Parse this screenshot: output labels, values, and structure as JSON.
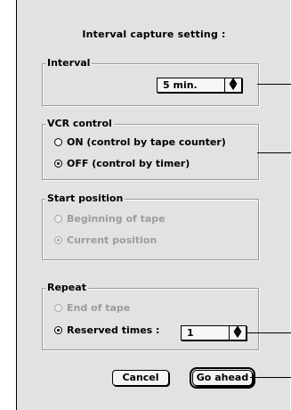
{
  "dialog": {
    "title": "Interval capture setting :"
  },
  "interval": {
    "label": "Interval",
    "selected": "5 min."
  },
  "vcr": {
    "label": "VCR control",
    "options": [
      "ON (control by tape counter)",
      "OFF (control by timer)"
    ],
    "selected_index": 1
  },
  "start": {
    "label": "Start position",
    "options": [
      "Beginning of tape",
      "Current position"
    ],
    "selected_index": 1,
    "enabled": false
  },
  "repeat": {
    "label": "Repeat",
    "options": [
      "End of tape",
      "Reserved times :"
    ],
    "selected_index": 1,
    "times_selected": "1"
  },
  "buttons": {
    "cancel": "Cancel",
    "go": "Go ahead"
  }
}
